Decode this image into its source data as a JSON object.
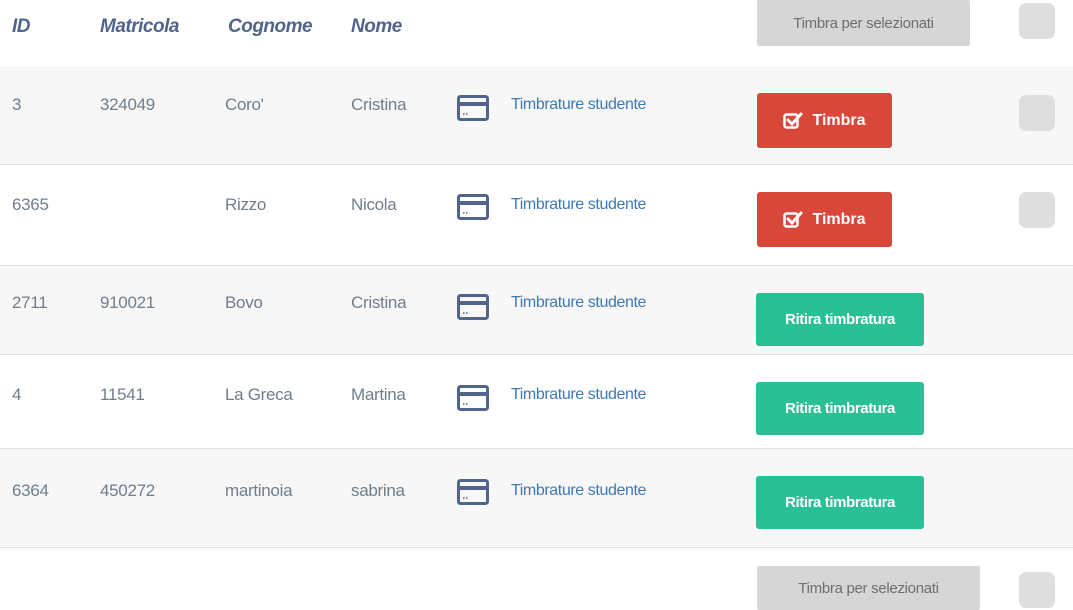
{
  "header": {
    "id": "ID",
    "matricola": "Matricola",
    "cognome": "Cognome",
    "nome": "Nome",
    "bulk_button": "Timbra per selezionati"
  },
  "rows": [
    {
      "id": "3",
      "matricola": "324049",
      "cognome": "Coro'",
      "nome": "Cristina",
      "link": "Timbrature studente",
      "action": "Timbra",
      "action_type": "timbra",
      "checkbox": true
    },
    {
      "id": "6365",
      "matricola": "",
      "cognome": "Rizzo",
      "nome": "Nicola",
      "link": "Timbrature studente",
      "action": "Timbra",
      "action_type": "timbra",
      "checkbox": true
    },
    {
      "id": "2711",
      "matricola": "910021",
      "cognome": "Bovo",
      "nome": "Cristina",
      "link": "Timbrature studente",
      "action": "Ritira timbratura",
      "action_type": "ritira",
      "checkbox": false
    },
    {
      "id": "4",
      "matricola": "11541",
      "cognome": "La Greca",
      "nome": "Martina",
      "link": "Timbrature studente",
      "action": "Ritira timbratura",
      "action_type": "ritira",
      "checkbox": false
    },
    {
      "id": "6364",
      "matricola": "450272",
      "cognome": "martinoia",
      "nome": "sabrina",
      "link": "Timbrature studente",
      "action": "Ritira timbratura",
      "action_type": "ritira",
      "checkbox": false
    }
  ],
  "footer": {
    "bulk_button": "Timbra per selezionati"
  },
  "colors": {
    "timbra": "#d9463a",
    "ritira": "#2bbf95",
    "link": "#3e79b4",
    "header_text": "#51648c"
  },
  "icons": {
    "card": "credit-card-icon",
    "check": "check-square-icon"
  }
}
